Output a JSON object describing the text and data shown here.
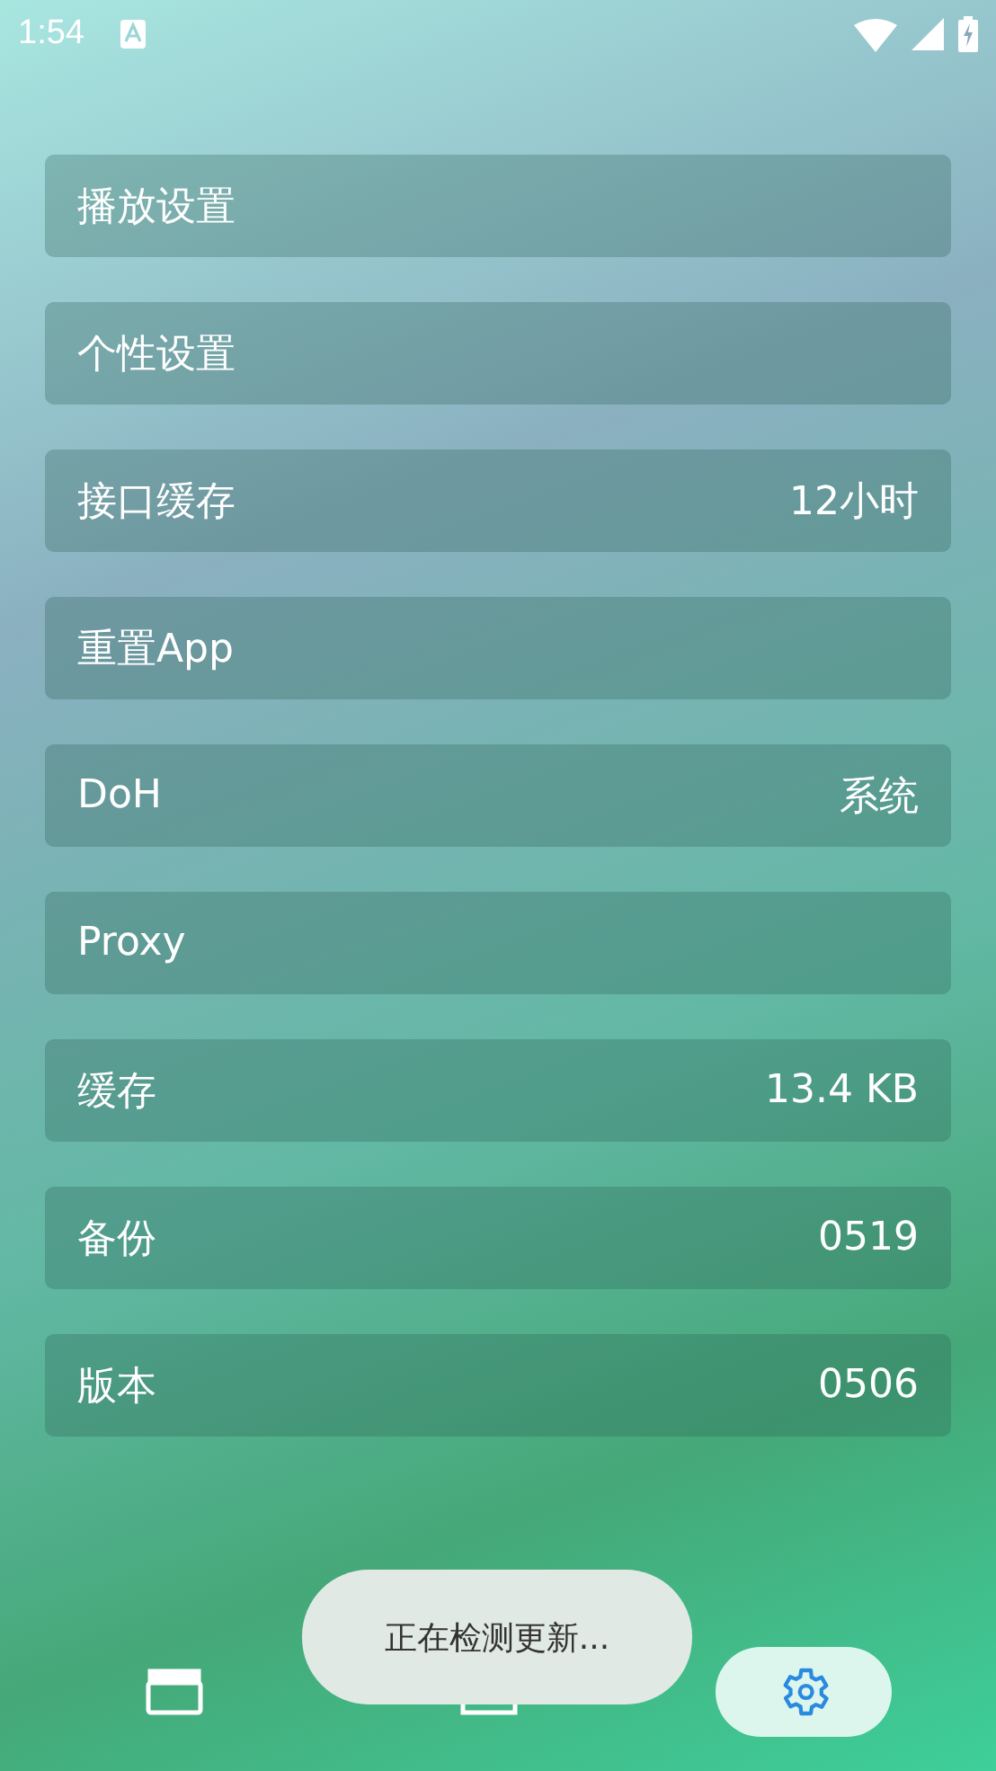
{
  "status_bar": {
    "time": "1:54"
  },
  "settings": [
    {
      "label": "播放设置"
    },
    {
      "label": "个性设置"
    },
    {
      "label": "接口缓存",
      "value": "12小时"
    },
    {
      "label": "重置App"
    },
    {
      "label": "DoH",
      "value": "系统"
    },
    {
      "label": "Proxy"
    },
    {
      "label": "缓存",
      "value": "13.4 KB"
    },
    {
      "label": "备份",
      "value": "0519"
    },
    {
      "label": "版本",
      "value": "0506"
    }
  ],
  "toast": "正在检测更新...",
  "nav": [
    {
      "kind": "movies",
      "selected": false
    },
    {
      "kind": "player",
      "selected": false
    },
    {
      "kind": "settings",
      "selected": true
    }
  ]
}
